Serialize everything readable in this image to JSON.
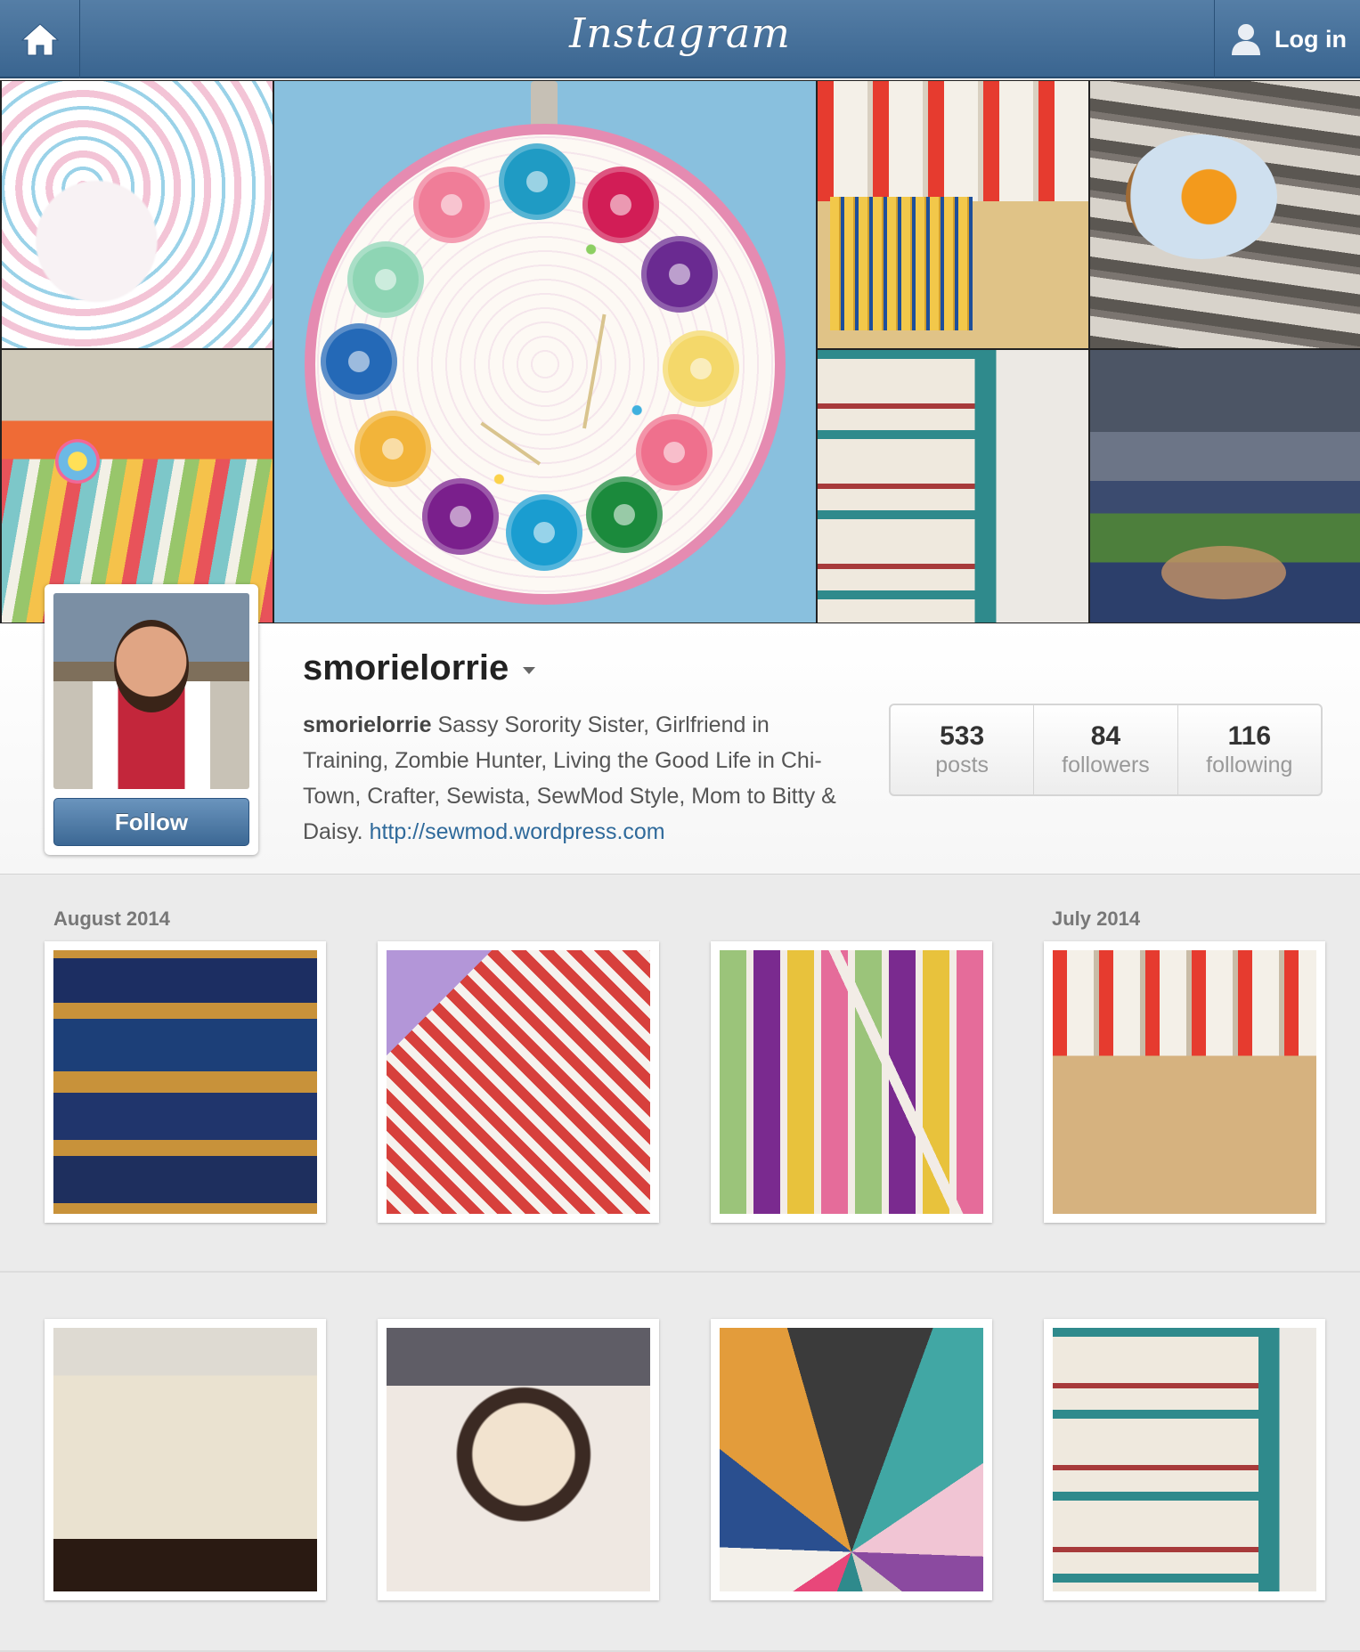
{
  "app": {
    "brand": "Instagram",
    "login_label": "Log in",
    "colors": {
      "topbar": "#4a739c",
      "link": "#2f6a9b",
      "follow_button": "#4a76a3"
    }
  },
  "profile": {
    "username": "smorielorrie",
    "bio_name": "smorielorrie",
    "bio_text": " Sassy Sorority Sister, Girlfriend in Training, Zombie Hunter, Living the Good Life in Chi-Town, Crafter, Sewista, SewMod Style, Mom to Bitty & Daisy. ",
    "website": "http://sewmod.wordpress.com",
    "follow_label": "Follow",
    "stats": [
      {
        "count": "533",
        "label": "posts"
      },
      {
        "count": "84",
        "label": "followers"
      },
      {
        "count": "116",
        "label": "following"
      }
    ]
  },
  "grid": {
    "month_labels": [
      "August 2014",
      "July 2014"
    ]
  },
  "icons": [
    "home-icon",
    "user-icon",
    "dropdown-caret-icon"
  ]
}
